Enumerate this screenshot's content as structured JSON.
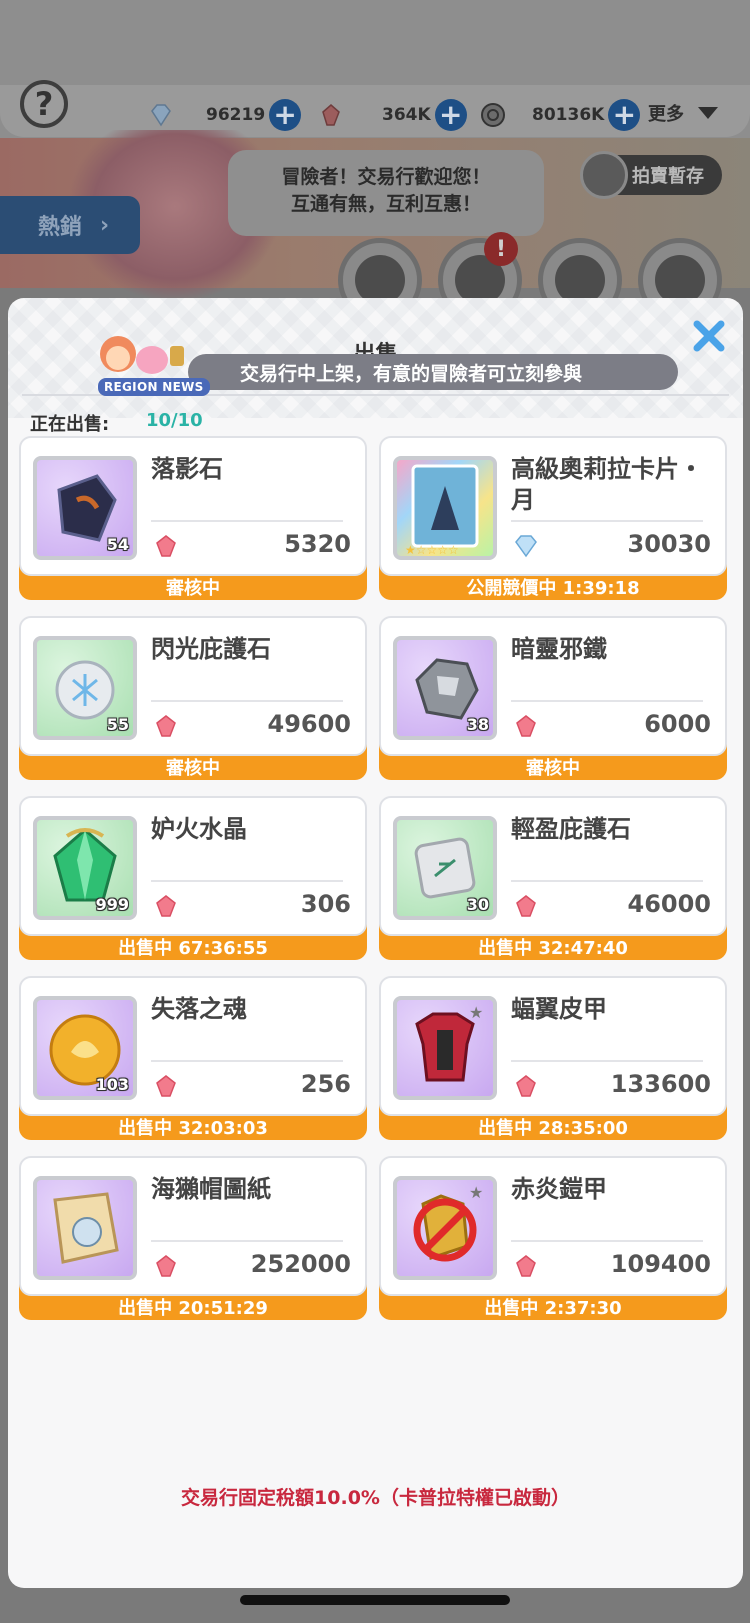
{
  "top": {
    "help": "?",
    "currencies": [
      {
        "name": "diamond",
        "icon": "diamond-icon",
        "amount": "96219"
      },
      {
        "name": "crystal",
        "icon": "red-crystal-icon",
        "amount": "364K"
      },
      {
        "name": "zeny",
        "icon": "zeny-coin-icon",
        "amount": "80136K"
      }
    ],
    "plus": "+",
    "more_label": "更多"
  },
  "banner": {
    "speech_line1": "冒險者！交易行歡迎您！",
    "speech_line2": "互通有無，互利互惠！",
    "hot_tab": "熱銷",
    "hot_arrow": "›",
    "auction_store": "拍賣暫存",
    "alert": "!"
  },
  "modal": {
    "title": "出售",
    "news_badge": "REGION NEWS",
    "news_text": "交易行中上架，有意的冒險者可立刻參與",
    "on_sale_label": "正在出售:",
    "on_sale_count": "10/10",
    "footer_note": "交易行固定稅額10.0%（卡普拉特權已啟動）"
  },
  "items": [
    {
      "name": "落影石",
      "qty": "54",
      "price": "5320",
      "currency": "red-crystal-icon",
      "status": "審核中",
      "bg": "purple",
      "art": "dark-stone-icon"
    },
    {
      "name": "高級奧莉拉卡片・月",
      "qty": "",
      "price": "30030",
      "currency": "diamond-icon",
      "status": "公開競價中 1:39:18",
      "bg": "rainbow",
      "art": "card-icon"
    },
    {
      "name": "閃光庇護石",
      "qty": "55",
      "price": "49600",
      "currency": "red-crystal-icon",
      "status": "審核中",
      "bg": "green",
      "art": "flash-stone-icon"
    },
    {
      "name": "暗靈邪鐵",
      "qty": "38",
      "price": "6000",
      "currency": "red-crystal-icon",
      "status": "審核中",
      "bg": "purple",
      "art": "ore-icon"
    },
    {
      "name": "妒火水晶",
      "qty": "999",
      "price": "306",
      "currency": "red-crystal-icon",
      "status": "出售中 67:36:55",
      "bg": "green",
      "art": "green-crystal-icon"
    },
    {
      "name": "輕盈庇護石",
      "qty": "30",
      "price": "46000",
      "currency": "red-crystal-icon",
      "status": "出售中 32:47:40",
      "bg": "green",
      "art": "rune-stone-icon"
    },
    {
      "name": "失落之魂",
      "qty": "103",
      "price": "256",
      "currency": "red-crystal-icon",
      "status": "出售中 32:03:03",
      "bg": "purple",
      "art": "soul-coin-icon"
    },
    {
      "name": "蝠翼皮甲",
      "qty": "",
      "price": "133600",
      "currency": "red-crystal-icon",
      "status": "出售中 28:35:00",
      "bg": "purple",
      "art": "armor-icon"
    },
    {
      "name": "海獺帽圖紙",
      "qty": "",
      "price": "252000",
      "currency": "red-crystal-icon",
      "status": "出售中 20:51:29",
      "bg": "purple",
      "art": "blueprint-icon"
    },
    {
      "name": "赤炎鎧甲",
      "qty": "",
      "price": "109400",
      "currency": "red-crystal-icon",
      "status": "出售中 2:37:30",
      "bg": "purple",
      "art": "forbidden-armor-icon"
    }
  ],
  "colors": {
    "status_bar": "#f59a1c",
    "count_teal": "#2ab3a6",
    "tax_red": "#c8283e",
    "close_blue": "#4aa3e8"
  }
}
